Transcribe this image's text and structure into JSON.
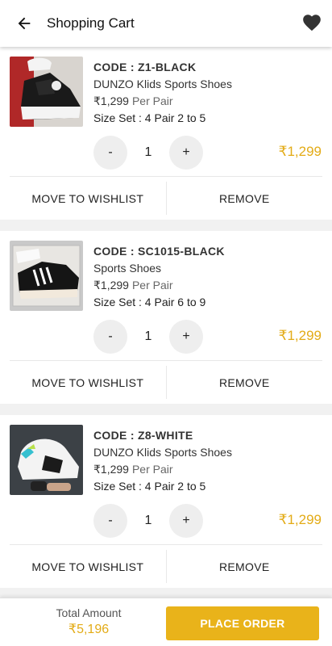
{
  "header": {
    "title": "Shopping Cart",
    "back_icon": "arrow-left-icon",
    "wishlist_icon": "heart-icon"
  },
  "colors": {
    "accent": "#e3ab16",
    "button": "#e9b31a"
  },
  "items": [
    {
      "code": "CODE : Z1-BLACK",
      "name": "DUNZO Klids Sports Shoes",
      "price": "₹1,299",
      "per": "Per Pair",
      "size_set": "Size Set : 4 Pair 2 to 5",
      "quantity": "1",
      "minus": "-",
      "plus": "+",
      "line_total": "₹1,299",
      "wishlist_label": "MOVE TO WISHLIST",
      "remove_label": "REMOVE"
    },
    {
      "code": "CODE : SC1015-BLACK",
      "name": "Sports Shoes",
      "price": "₹1,299",
      "per": "Per Pair",
      "size_set": "Size Set : 4 Pair 6 to 9",
      "quantity": "1",
      "minus": "-",
      "plus": "+",
      "line_total": "₹1,299",
      "wishlist_label": "MOVE TO WISHLIST",
      "remove_label": "REMOVE"
    },
    {
      "code": "CODE : Z8-WHITE",
      "name": "DUNZO Klids Sports Shoes",
      "price": "₹1,299",
      "per": "Per Pair",
      "size_set": "Size Set : 4 Pair 2 to 5",
      "quantity": "1",
      "minus": "-",
      "plus": "+",
      "line_total": "₹1,299",
      "wishlist_label": "MOVE TO WISHLIST",
      "remove_label": "REMOVE"
    }
  ],
  "footer": {
    "total_label": "Total Amount",
    "total_value": "₹5,196",
    "place_order_label": "PLACE ORDER"
  }
}
